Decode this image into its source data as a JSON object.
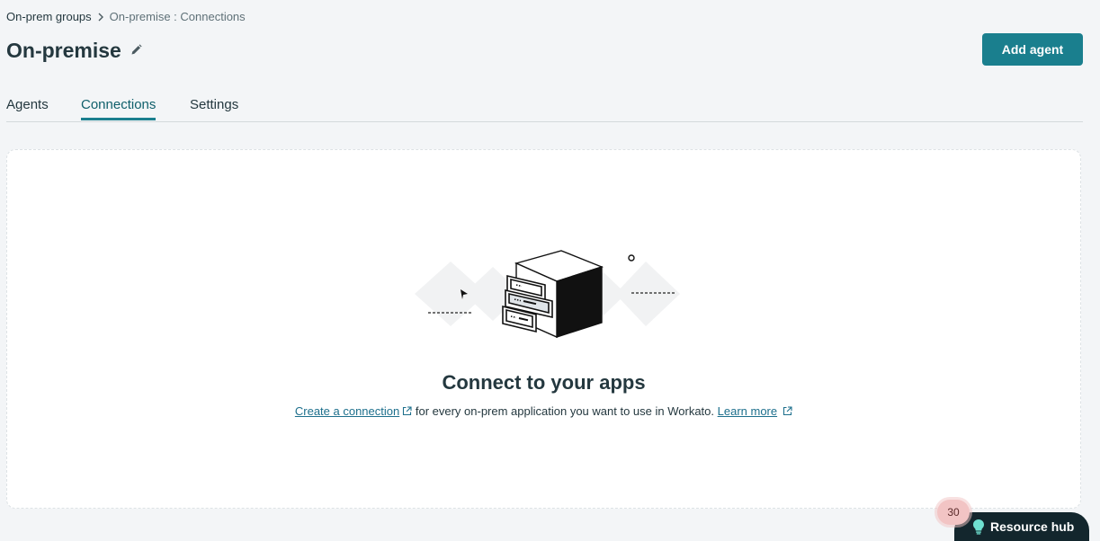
{
  "breadcrumb": {
    "parent": "On-prem groups",
    "current": "On-premise : Connections"
  },
  "header": {
    "title": "On-premise",
    "add_agent_label": "Add agent"
  },
  "tabs": [
    {
      "label": "Agents",
      "active": false
    },
    {
      "label": "Connections",
      "active": true
    },
    {
      "label": "Settings",
      "active": false
    }
  ],
  "empty_state": {
    "title": "Connect to your apps",
    "create_link": "Create a connection",
    "middle_text": "for every on-prem application you want to use in Workato.",
    "learn_more": "Learn more"
  },
  "resource_hub": {
    "label": "Resource hub",
    "badge_count": "30"
  },
  "colors": {
    "accent": "#1a7f8e",
    "link": "#1d6f8c",
    "text": "#24383f",
    "background": "#f3f5f7"
  },
  "icons": [
    "chevron-right-icon",
    "pencil-icon",
    "external-link-icon",
    "lightbulb-icon",
    "server-illustration"
  ]
}
